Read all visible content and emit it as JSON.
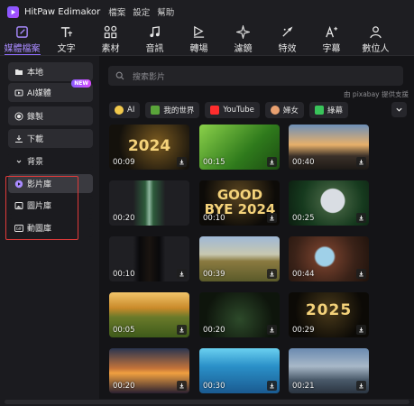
{
  "titlebar": {
    "app_name": "HitPaw Edimakor",
    "menus": [
      "檔案",
      "設定",
      "幫助"
    ]
  },
  "toolbar": {
    "items": [
      {
        "label": "媒體檔案",
        "icon": "media-icon",
        "active": true
      },
      {
        "label": "文字",
        "icon": "text-icon"
      },
      {
        "label": "素材",
        "icon": "elements-icon"
      },
      {
        "label": "音訊",
        "icon": "music-icon"
      },
      {
        "label": "轉場",
        "icon": "transition-icon"
      },
      {
        "label": "濾鏡",
        "icon": "filter-icon"
      },
      {
        "label": "特效",
        "icon": "effects-icon"
      },
      {
        "label": "字幕",
        "icon": "subtitle-icon"
      },
      {
        "label": "數位人",
        "icon": "avatar-icon"
      }
    ]
  },
  "sidebar": {
    "items": [
      {
        "label": "本地",
        "icon": "folder-icon"
      },
      {
        "label": "AI媒體",
        "icon": "ai-media-icon",
        "badge": "NEW"
      },
      {
        "label": "錄製",
        "icon": "record-icon"
      },
      {
        "label": "下載",
        "icon": "download-icon"
      },
      {
        "label": "背景",
        "icon": "background-icon"
      },
      {
        "label": "影片庫",
        "icon": "video-library-icon",
        "active": true
      },
      {
        "label": "圖片庫",
        "icon": "image-library-icon"
      },
      {
        "label": "動圖庫",
        "icon": "gif-library-icon"
      }
    ]
  },
  "search": {
    "placeholder": "搜索影片"
  },
  "provider_text": "由 pixabay 提供支援",
  "chips": [
    {
      "label": "AI",
      "icon": "bulb-icon",
      "color": "#f2c94c"
    },
    {
      "label": "我的世界",
      "icon": "minecraft-icon",
      "color": "#5aa43a"
    },
    {
      "label": "YouTube",
      "icon": "youtube-icon",
      "color": "#ff2d2d"
    },
    {
      "label": "婦女",
      "icon": "woman-icon",
      "color": "#e8a070"
    },
    {
      "label": "綠幕",
      "icon": "greenscreen-icon",
      "color": "#39c35a"
    }
  ],
  "videos": [
    {
      "duration": "00:09",
      "overlay": "2024"
    },
    {
      "duration": "00:15",
      "overlay": ""
    },
    {
      "duration": "00:40",
      "overlay": ""
    },
    {
      "duration": "",
      "overlay": ""
    },
    {
      "duration": "00:10",
      "overlay": "GOOD BYE 2024"
    },
    {
      "duration": "00:25",
      "overlay": ""
    },
    {
      "duration": "00:10",
      "overlay": ""
    },
    {
      "duration": "00:39",
      "overlay": ""
    },
    {
      "duration": "00:44",
      "overlay": ""
    },
    {
      "duration": "00:05",
      "overlay": ""
    },
    {
      "duration": "00:20",
      "overlay": ""
    },
    {
      "duration": "00:29",
      "overlay": "2025"
    },
    {
      "duration": "00:20",
      "overlay": ""
    },
    {
      "duration": "00:30",
      "overlay": ""
    },
    {
      "duration": "00:21",
      "overlay": ""
    }
  ],
  "video_left_second_row_dur": "00:20"
}
